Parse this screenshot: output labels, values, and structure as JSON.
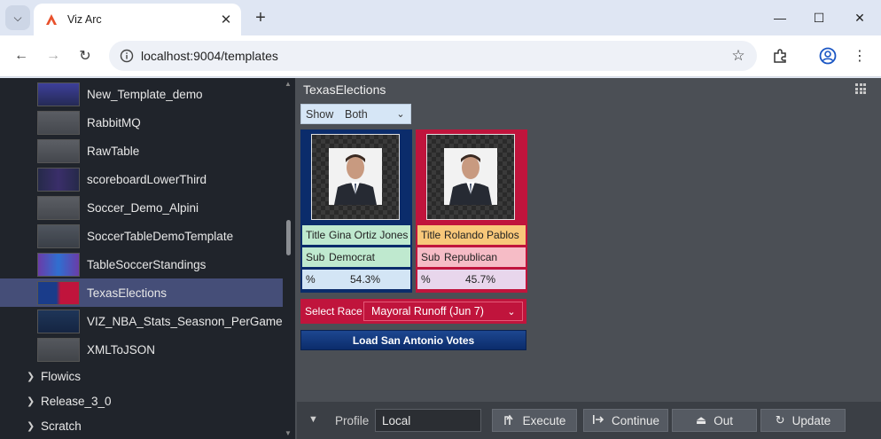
{
  "browser": {
    "tab_title": "Viz Arc",
    "url": "localhost:9004/templates",
    "accent": "#dfe6f3"
  },
  "sidebar": {
    "items": [
      {
        "label": "New_Template_demo"
      },
      {
        "label": "RabbitMQ"
      },
      {
        "label": "RawTable"
      },
      {
        "label": "scoreboardLowerThird"
      },
      {
        "label": "Soccer_Demo_Alpini"
      },
      {
        "label": "SoccerTableDemoTemplate"
      },
      {
        "label": "TableSoccerStandings"
      },
      {
        "label": "TexasElections"
      },
      {
        "label": "VIZ_NBA_Stats_Seasnon_PerGame"
      },
      {
        "label": "XMLToJSON"
      }
    ],
    "folders": [
      {
        "label": "Flowics"
      },
      {
        "label": "Release_3_0"
      },
      {
        "label": "Scratch"
      }
    ]
  },
  "main": {
    "title": "TexasElections",
    "show_label": "Show",
    "show_value": "Both",
    "candidates": [
      {
        "title_label": "Title",
        "title_value": "Gina Ortiz Jones",
        "sub_label": "Sub",
        "sub_value": "Democrat",
        "pct_label": "%",
        "pct_value": "54.3%",
        "color": "#0b2c6b"
      },
      {
        "title_label": "Title",
        "title_value": "Rolando Pablos",
        "sub_label": "Sub",
        "sub_value": "Republican",
        "pct_label": "%",
        "pct_value": "45.7%",
        "color": "#c0143c"
      }
    ],
    "race_label": "Select Race",
    "race_value": "Mayoral Runoff (Jun 7)",
    "load_button": "Load San Antonio Votes"
  },
  "bottom": {
    "profile_label": "Profile",
    "profile_value": "Local",
    "execute": "Execute",
    "continue": "Continue",
    "out": "Out",
    "update": "Update"
  }
}
